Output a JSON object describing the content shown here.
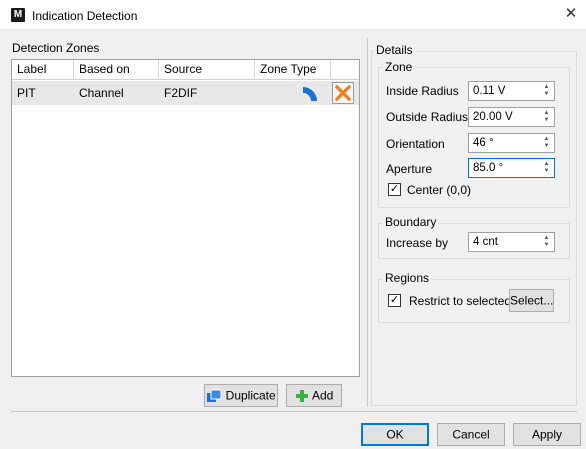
{
  "window": {
    "app_icon_letter": "M",
    "title": "Indication Detection",
    "close_glyph": "✕"
  },
  "detection_zones": {
    "title": "Detection Zones",
    "columns": [
      "Label",
      "Based on",
      "Source",
      "Zone Type"
    ],
    "rows": [
      {
        "label": "PIT",
        "based_on": "Channel",
        "source": "F2DIF",
        "zone_type_icon": "quarter-ring-icon",
        "delete_icon": "delete-x-icon"
      }
    ],
    "duplicate_label": "Duplicate",
    "add_label": "Add"
  },
  "details": {
    "title": "Details",
    "zone": {
      "title": "Zone",
      "inside_radius_label": "Inside Radius",
      "inside_radius_value": "0.11 V",
      "outside_radius_label": "Outside Radius",
      "outside_radius_value": "20.00 V",
      "orientation_label": "Orientation",
      "orientation_value": "46 °",
      "aperture_label": "Aperture",
      "aperture_value": "85.0 °",
      "center_label": "Center (0,0)",
      "center_checked": true
    },
    "boundary": {
      "title": "Boundary",
      "increase_label": "Increase by",
      "increase_value": "4 cnt"
    },
    "regions": {
      "title": "Regions",
      "restrict_label": "Restrict to selected",
      "restrict_checked": true,
      "select_label": "Select..."
    }
  },
  "footer": {
    "ok_label": "OK",
    "cancel_label": "Cancel",
    "apply_label": "Apply"
  },
  "colors": {
    "accent_blue": "#0078d7",
    "zone_icon_blue": "#1e6fd0",
    "delete_orange": "#f07d1a",
    "add_green": "#3cb043"
  }
}
